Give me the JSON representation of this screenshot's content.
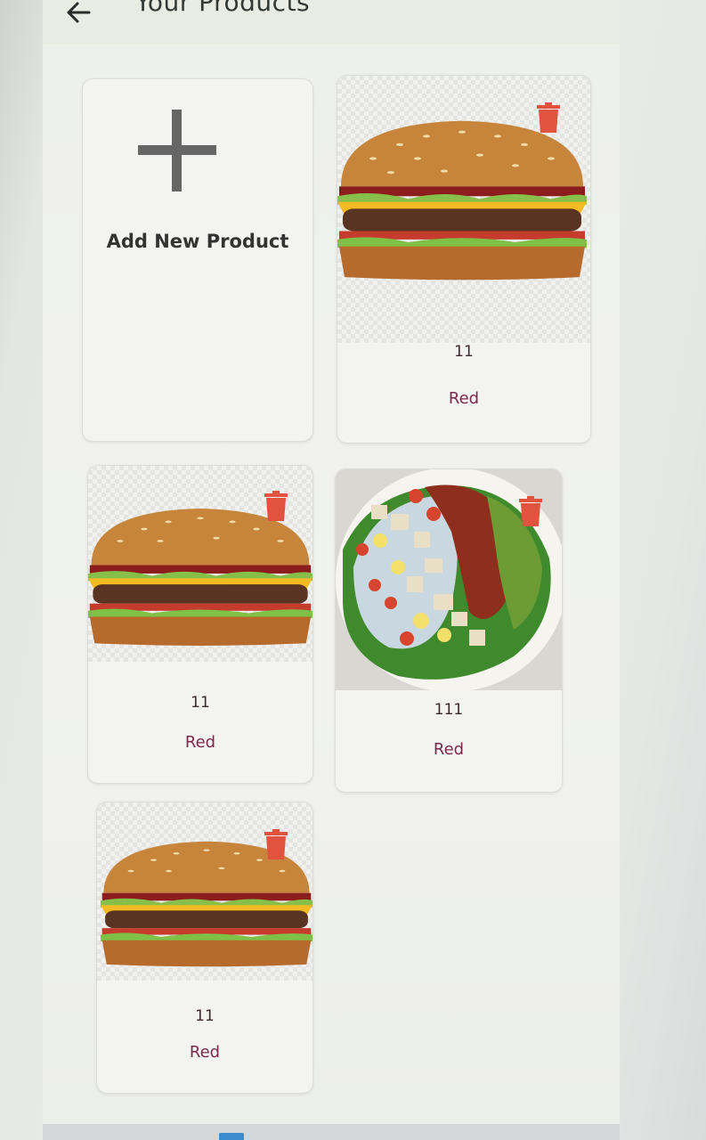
{
  "header": {
    "title": "Your Products",
    "back_icon": "arrow-left-icon"
  },
  "add_card": {
    "label": "Add New Product",
    "icon": "plus-icon"
  },
  "products": [
    {
      "price": "11",
      "color": "Red",
      "image": "burger",
      "delete_icon": "trash-icon"
    },
    {
      "price": "11",
      "color": "Red",
      "image": "burger",
      "delete_icon": "trash-icon"
    },
    {
      "price": "111",
      "color": "Red",
      "image": "salad",
      "delete_icon": "trash-icon"
    },
    {
      "price": "11",
      "color": "Red",
      "image": "burger",
      "delete_icon": "trash-icon"
    }
  ],
  "colors": {
    "trash": "#e2533f",
    "price_text": "#3c2a33",
    "color_text": "#7a2a4c"
  }
}
